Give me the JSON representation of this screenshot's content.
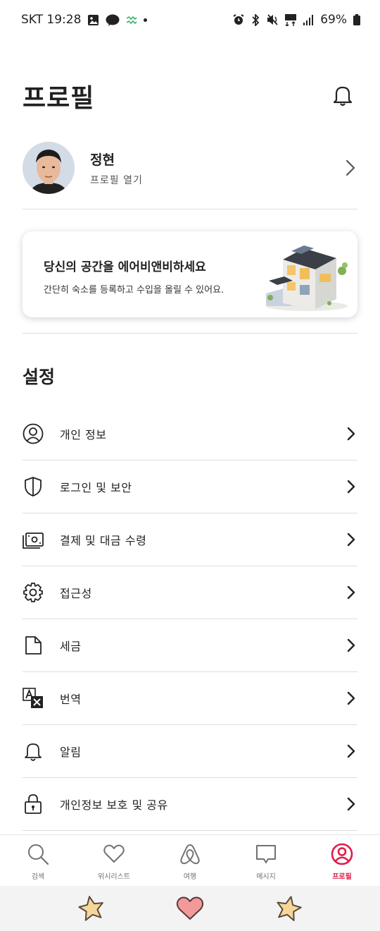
{
  "status_bar": {
    "carrier_time": "SKT 19:28",
    "battery": "69%"
  },
  "header": {
    "title": "프로필"
  },
  "profile": {
    "name": "정현",
    "subtitle": "프로필 열기"
  },
  "host_card": {
    "title": "당신의 공간을 에어비앤비하세요",
    "subtitle": "간단히 숙소를 등록하고 수입을 올릴 수 있어요."
  },
  "settings": {
    "title": "설정",
    "items": [
      {
        "label": "개인 정보",
        "icon": "user-circle-icon"
      },
      {
        "label": "로그인 및 보안",
        "icon": "shield-icon"
      },
      {
        "label": "결제 및 대금 수령",
        "icon": "payments-icon"
      },
      {
        "label": "접근성",
        "icon": "gear-icon"
      },
      {
        "label": "세금",
        "icon": "document-icon"
      },
      {
        "label": "번역",
        "icon": "translate-icon"
      },
      {
        "label": "알림",
        "icon": "bell-icon"
      },
      {
        "label": "개인정보 보호 및 공유",
        "icon": "lock-icon"
      }
    ]
  },
  "bottom_nav": {
    "active_color": "#E11D48",
    "tabs": [
      {
        "label": "검색",
        "icon": "search-icon"
      },
      {
        "label": "위시리스트",
        "icon": "heart-icon"
      },
      {
        "label": "여행",
        "icon": "airbnb-logo-icon"
      },
      {
        "label": "메시지",
        "icon": "message-icon"
      },
      {
        "label": "프로필",
        "icon": "profile-icon",
        "active": true
      }
    ]
  }
}
